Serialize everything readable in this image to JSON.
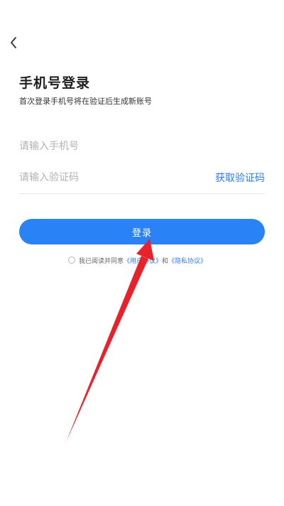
{
  "nav": {
    "back_icon": "chevron-left-icon"
  },
  "header": {
    "title": "手机号登录",
    "subtitle": "首次登录手机号将在验证后生成新账号"
  },
  "form": {
    "phone_placeholder": "请输入手机号",
    "phone_value": "",
    "code_placeholder": "请输入验证码",
    "code_value": "",
    "get_code_label": "获取验证码",
    "login_label": "登录"
  },
  "agreement": {
    "checked": false,
    "prefix": "我已阅读并同意",
    "user_agreement": "《用户协议》",
    "conjunction": "和",
    "privacy_policy": "《隐私协议》"
  },
  "colors": {
    "accent": "#2a82f7",
    "link": "#2a7bf6",
    "annotation_arrow": "#e8212b"
  }
}
